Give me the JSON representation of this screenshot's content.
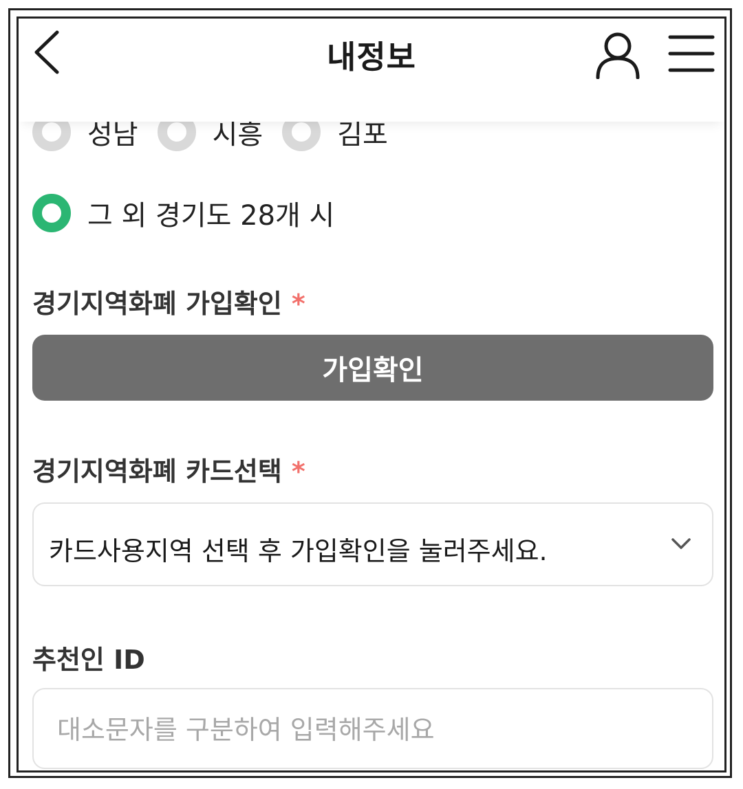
{
  "header": {
    "title": "내정보",
    "back_icon": "chevron-left-icon",
    "profile_icon": "user-icon",
    "menu_icon": "hamburger-menu-icon"
  },
  "region": {
    "options_row1": [
      {
        "label": "성남",
        "checked": false
      },
      {
        "label": "시흥",
        "checked": false
      },
      {
        "label": "김포",
        "checked": false
      }
    ],
    "other_option": {
      "label": "그 외 경기도 28개 시",
      "checked": true
    }
  },
  "membership": {
    "label": "경기지역화폐 가입확인",
    "required_mark": "*",
    "button_label": "가입확인"
  },
  "card_select": {
    "label": "경기지역화폐 카드선택",
    "required_mark": "*",
    "value": "카드사용지역 선택 후 가입확인을 눌러주세요."
  },
  "referrer": {
    "label": "추천인 ID",
    "placeholder": "대소문자를 구분하여 입력해주세요"
  },
  "colors": {
    "accent_green": "#2bb673",
    "button_gray": "#6e6e6e",
    "required_red": "#f2706b"
  }
}
